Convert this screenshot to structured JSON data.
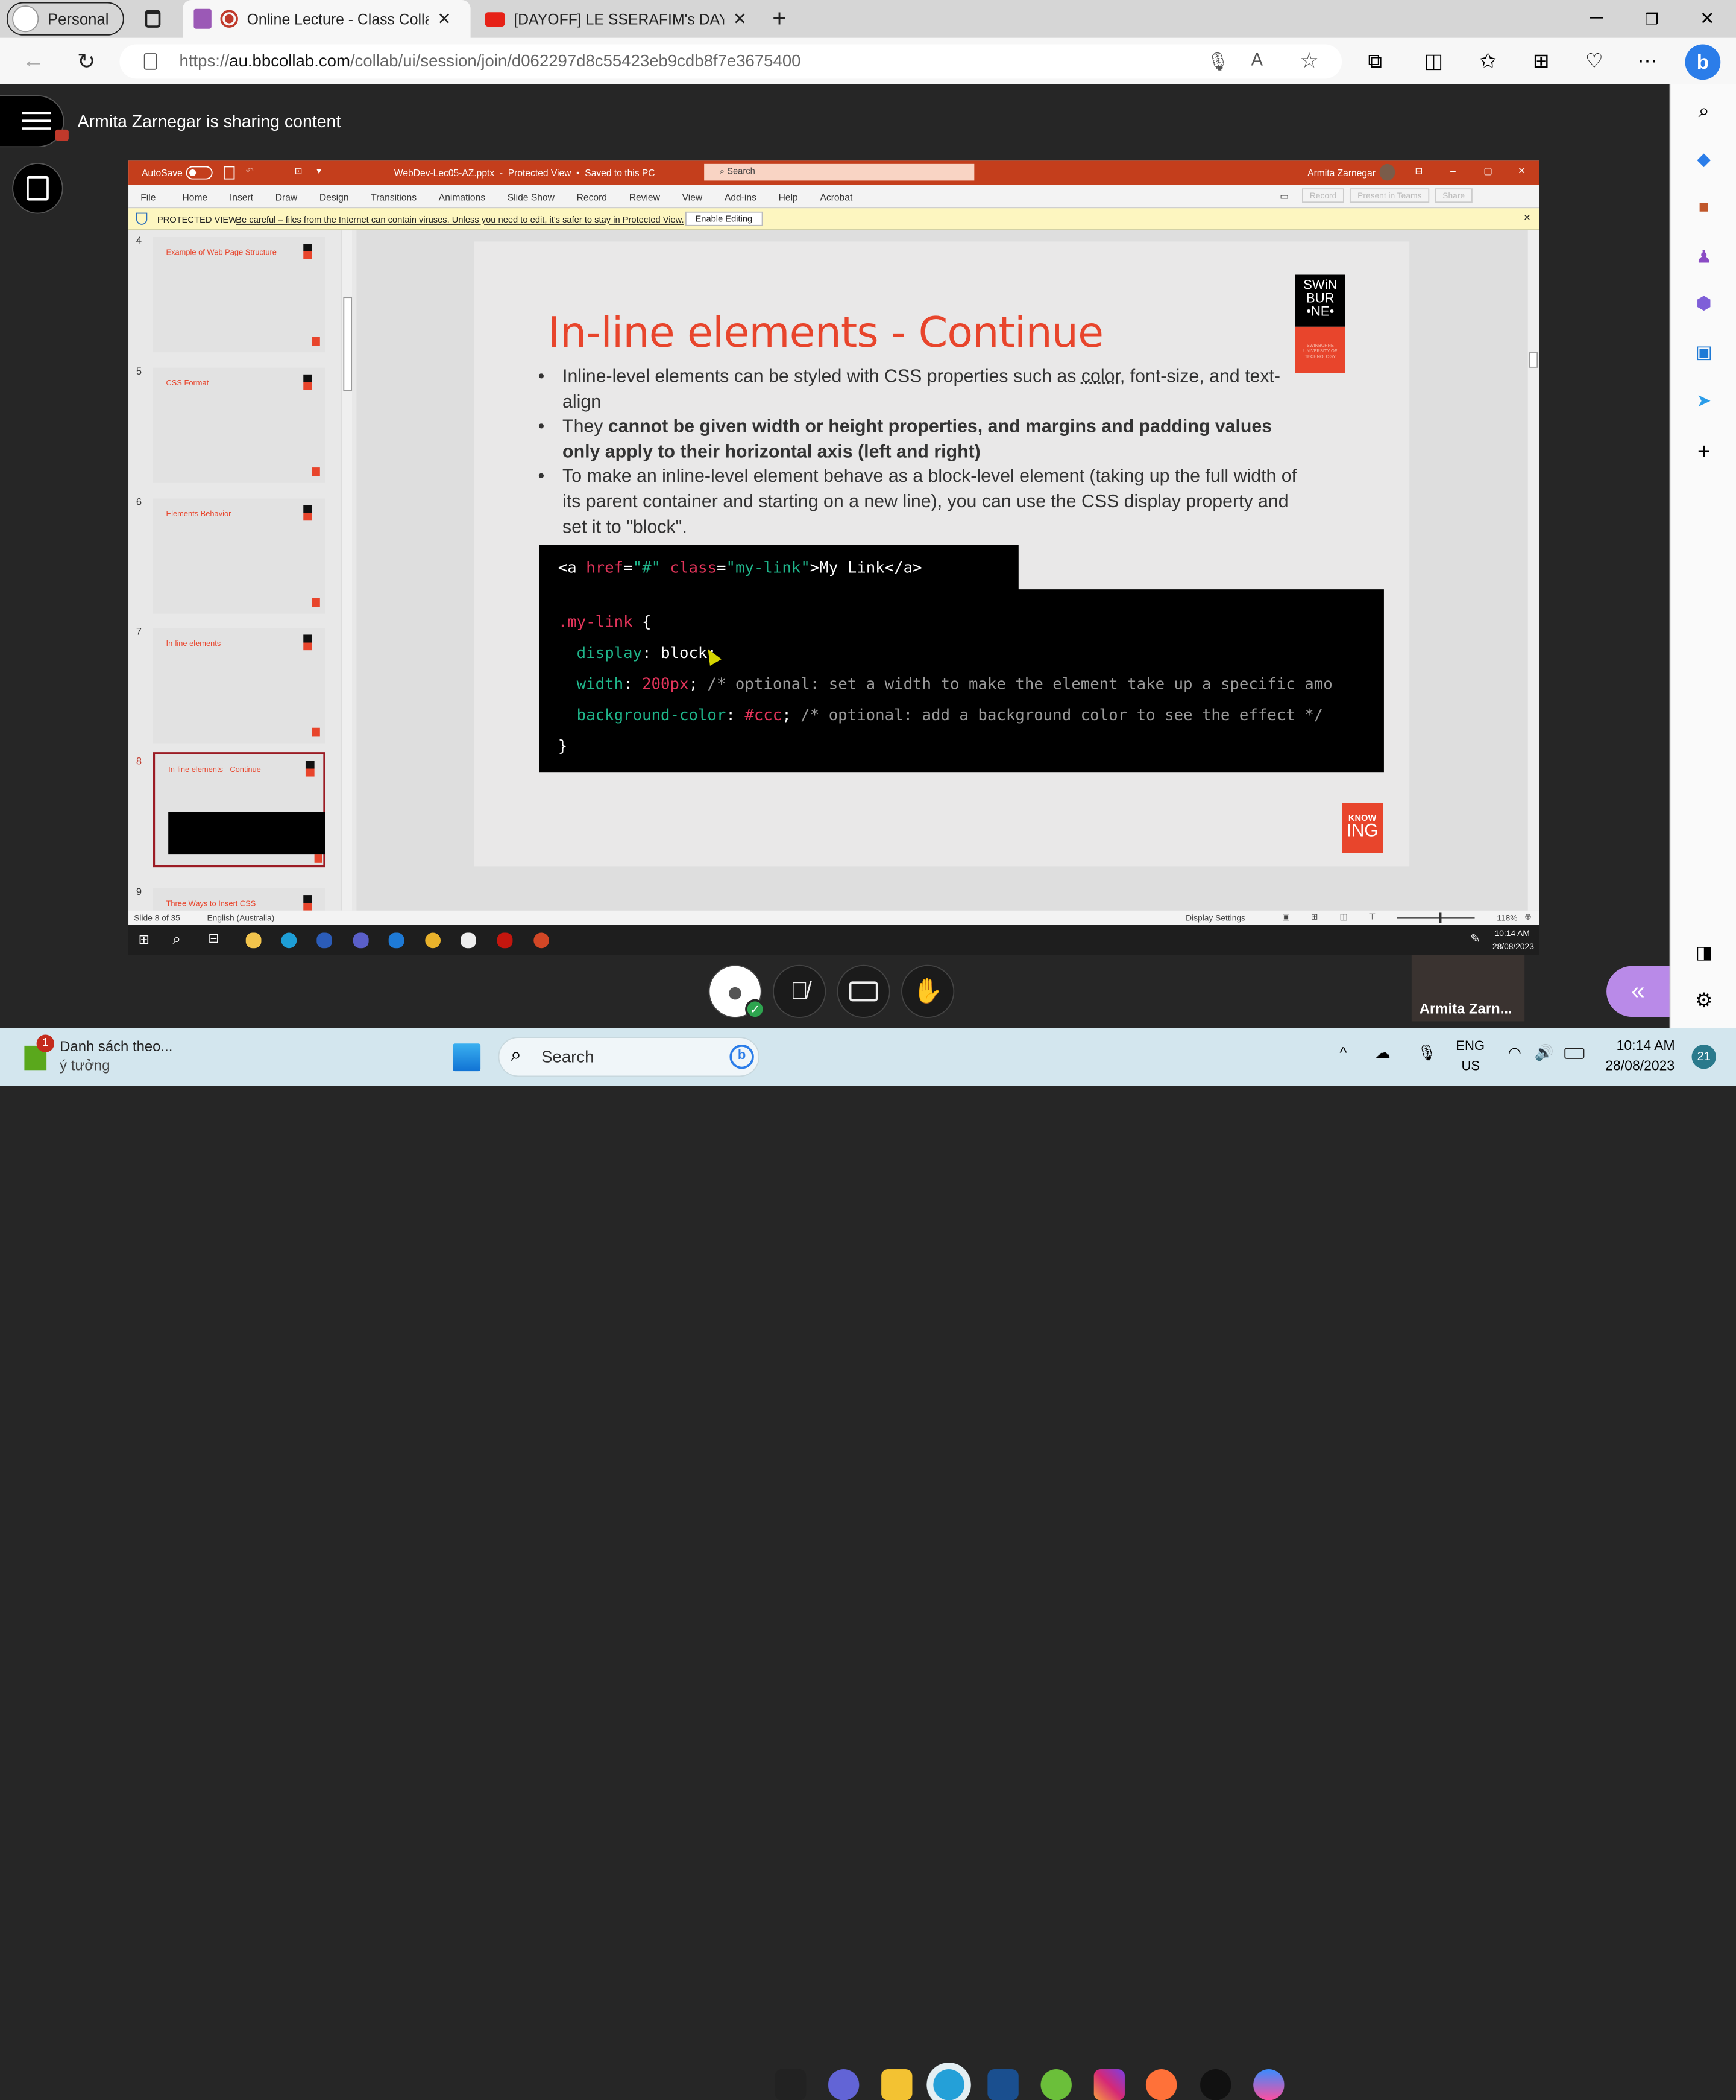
{
  "browser": {
    "profile_label": "Personal",
    "tabs": [
      {
        "title": "Online Lecture - Class Collab",
        "active": true
      },
      {
        "title": "[DAYOFF] LE SSERAFIM's DAY OFF",
        "active": false
      }
    ],
    "url_prefix": "https://",
    "url_host": "au.bbcollab.com",
    "url_path": "/collab/ui/session/join/d062297d8c55423eb9cdb8f7e3675400"
  },
  "collab": {
    "sharing_text": "Armita Zarnegar is sharing content",
    "participant_name": "Armita Zarn...",
    "accent": "#b98ae8"
  },
  "ppt": {
    "autosave_label": "AutoSave",
    "file_title": "WebDev-Lec05-AZ.pptx  -  Protected View  •  Saved to this PC",
    "search_placeholder": "Search",
    "user_name": "Armita Zarnegar",
    "ribbon_tabs": [
      "File",
      "Home",
      "Insert",
      "Draw",
      "Design",
      "Transitions",
      "Animations",
      "Slide Show",
      "Record",
      "Review",
      "View",
      "Add-ins",
      "Help",
      "Acrobat"
    ],
    "ribbon_buttons": [
      "Record",
      "Present in Teams",
      "Share"
    ],
    "protected_label": "PROTECTED VIEW",
    "protected_message": "Be careful – files from the Internet can contain viruses. Unless you need to edit, it's safer to stay in Protected View.",
    "enable_editing": "Enable Editing",
    "thumbnails": [
      {
        "num": "4",
        "title": "Example of Web Page Structure"
      },
      {
        "num": "5",
        "title": "CSS Format"
      },
      {
        "num": "6",
        "title": "Elements Behavior"
      },
      {
        "num": "7",
        "title": "In-line elements"
      },
      {
        "num": "8",
        "title": "In-line elements - Continue",
        "selected": true
      },
      {
        "num": "9",
        "title": "Three Ways to Insert CSS"
      }
    ],
    "status_slide": "Slide 8 of 35",
    "status_lang": "English (Australia)",
    "display_settings": "Display Settings",
    "zoom_percent": "118%",
    "brand_color": "#c43e1c"
  },
  "slide": {
    "title": "In-line elements - Continue",
    "bullets": [
      [
        {
          "t": "Inline-level elements can be styled with CSS properties such as "
        },
        {
          "t": "color",
          "u": true
        },
        {
          "t": ", font-size, and text-align"
        }
      ],
      [
        {
          "t": "They "
        },
        {
          "t": "cannot be given width or height properties, and margins and padding values only apply to their horizontal axis (left and right)",
          "b": true
        }
      ],
      [
        {
          "t": "To make an inline-level element behave as a block-level element (taking up the full width of its parent container and starting on a new line), you can use the CSS display property and set it to \"block\"."
        }
      ]
    ],
    "code_html": [
      {
        "t": "<a ",
        "c": "#fff"
      },
      {
        "t": "href",
        "c": "#e2345a"
      },
      {
        "t": "=",
        "c": "#fff"
      },
      {
        "t": "\"#\"",
        "c": "#1fb58a"
      },
      {
        "t": " class",
        "c": "#e2345a"
      },
      {
        "t": "=",
        "c": "#fff"
      },
      {
        "t": "\"my-link\"",
        "c": "#1fb58a"
      },
      {
        "t": ">My Link</a>",
        "c": "#fff"
      }
    ],
    "code_css": [
      [
        {
          "t": ".my-link",
          "c": "#e2345a"
        },
        {
          "t": " {",
          "c": "#fff"
        }
      ],
      [
        {
          "t": "  display",
          "c": "#1fb58a"
        },
        {
          "t": ": block;",
          "c": "#fff"
        }
      ],
      [
        {
          "t": "  width",
          "c": "#1fb58a"
        },
        {
          "t": ": ",
          "c": "#fff"
        },
        {
          "t": "200px",
          "c": "#e2345a"
        },
        {
          "t": "; ",
          "c": "#fff"
        },
        {
          "t": "/* optional: set a width to make the element take up a specific amo",
          "c": "#9a9a9a"
        }
      ],
      [
        {
          "t": "  background-color",
          "c": "#1fb58a"
        },
        {
          "t": ": ",
          "c": "#fff"
        },
        {
          "t": "#ccc",
          "c": "#e2345a"
        },
        {
          "t": "; ",
          "c": "#fff"
        },
        {
          "t": "/* optional: add a background color to see the effect */",
          "c": "#9a9a9a"
        }
      ],
      [
        {
          "t": "}",
          "c": "#fff"
        }
      ]
    ],
    "logo_text": [
      "SWiN",
      "BUR",
      "•NE•"
    ],
    "logo_sub": "SWINBURNE UNIVERSITY OF TECHNOLOGY",
    "badge_text": [
      "KNOW",
      "ING"
    ],
    "red": "#e8452c"
  },
  "shared_taskbar": {
    "time": "10:14 AM",
    "date": "28/08/2023"
  },
  "windows_taskbar": {
    "widget_title": "Danh sách theo...",
    "widget_sub": "ý tưởng",
    "widget_badge": "1",
    "search_label": "Search",
    "lang_top": "ENG",
    "lang_bottom": "US",
    "time": "10:14 AM",
    "date": "28/08/2023",
    "notif_count": "21"
  }
}
